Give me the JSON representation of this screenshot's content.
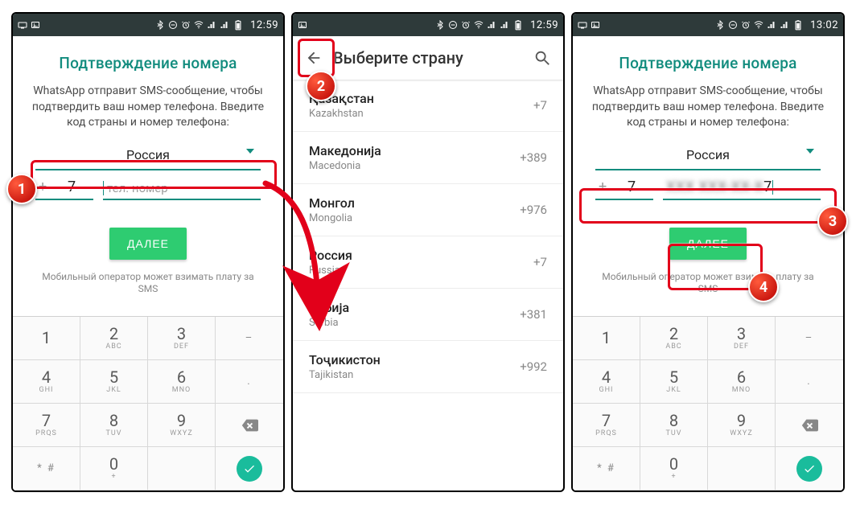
{
  "status": {
    "time1": "12:59",
    "time2": "12:59",
    "time3": "13:02"
  },
  "verify": {
    "title": "Подтверждение номера",
    "subtitle": "WhatsApp отправит SMS-сообщение, чтобы подтвердить ваш номер телефона. Введите код страны и номер телефона:",
    "country": "Россия",
    "cc_plus": "+",
    "cc_value": "7",
    "phone_placeholder": "тел. номер",
    "phone_entered_tail": "7",
    "next_label": "ДАЛЕЕ",
    "sms_note": "Мобильный оператор может взимать плату за SMS"
  },
  "keypad": {
    "keys": [
      {
        "n": "1",
        "s": ""
      },
      {
        "n": "2",
        "s": "ABC"
      },
      {
        "n": "3",
        "s": "DEF"
      },
      {
        "side": "–"
      },
      {
        "n": "4",
        "s": "GHI"
      },
      {
        "n": "5",
        "s": "JKL"
      },
      {
        "n": "6",
        "s": "MNO"
      },
      {
        "side": "."
      },
      {
        "n": "7",
        "s": "PRQS"
      },
      {
        "n": "8",
        "s": "TUV"
      },
      {
        "n": "9",
        "s": "WXYZ"
      },
      {
        "back": true
      },
      {
        "side": "* #"
      },
      {
        "n": "0",
        "s": "+"
      },
      {
        "side": ""
      },
      {
        "done": true
      }
    ]
  },
  "picker": {
    "title": "Выберите страну",
    "items": [
      {
        "name": "Қазақстан",
        "sub": "Kazakhstan",
        "code": "+7"
      },
      {
        "name": "Македонија",
        "sub": "Macedonia",
        "code": "+389"
      },
      {
        "name": "Монгол",
        "sub": "Mongolia",
        "code": "+976"
      },
      {
        "name": "Россия",
        "sub": "Russia",
        "code": "+7"
      },
      {
        "name": "Србија",
        "sub": "Serbia",
        "code": "+381"
      },
      {
        "name": "Тоҷикистон",
        "sub": "Tajikistan",
        "code": "+992"
      }
    ]
  },
  "anno": {
    "n1": "1",
    "n2": "2",
    "n3": "3",
    "n4": "4"
  }
}
